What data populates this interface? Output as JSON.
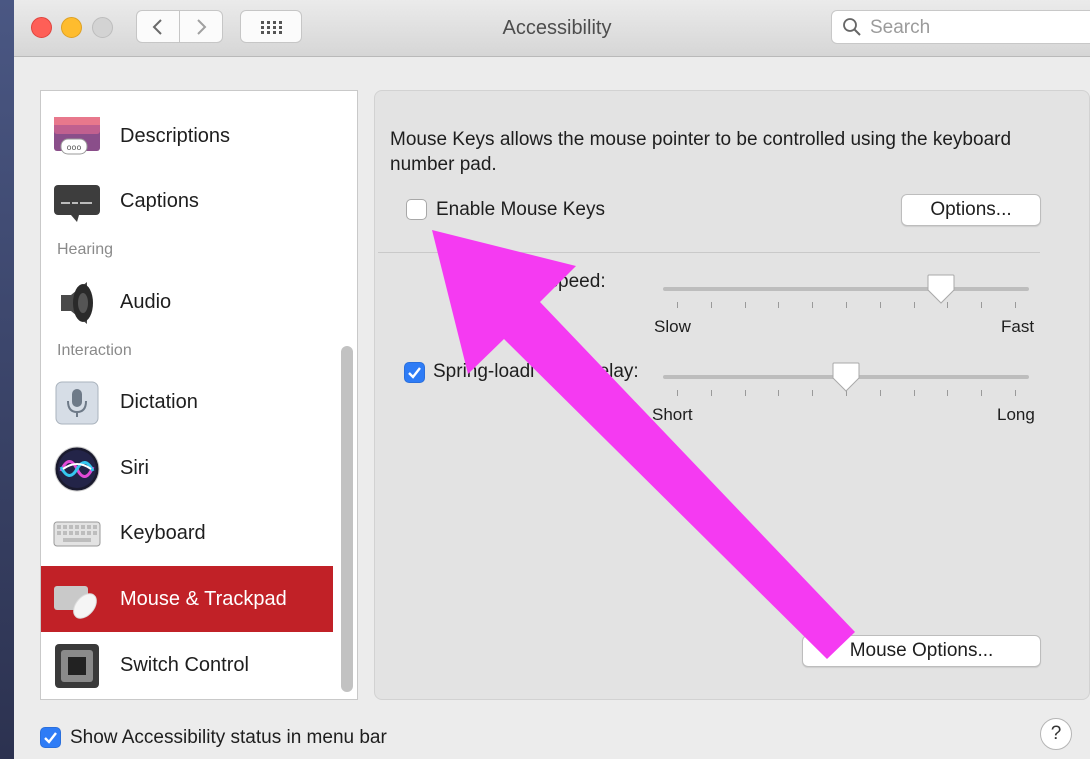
{
  "window": {
    "title": "Accessibility",
    "search_placeholder": "Search"
  },
  "sidebar": {
    "items": [
      {
        "label": "Descriptions",
        "icon": "descriptions-icon"
      },
      {
        "label": "Captions",
        "icon": "captions-icon"
      },
      {
        "label": "Audio",
        "icon": "speaker-icon"
      },
      {
        "label": "Dictation",
        "icon": "microphone-icon"
      },
      {
        "label": "Siri",
        "icon": "siri-icon"
      },
      {
        "label": "Keyboard",
        "icon": "keyboard-icon"
      },
      {
        "label": "Mouse & Trackpad",
        "icon": "mouse-trackpad-icon",
        "selected": true
      },
      {
        "label": "Switch Control",
        "icon": "switch-control-icon"
      }
    ],
    "sections": [
      "Hearing",
      "Interaction"
    ]
  },
  "panel": {
    "description": "Mouse Keys allows the mouse pointer to be controlled using the keyboard number pad.",
    "mouse_keys": {
      "label": "Enable Mouse Keys",
      "checked": false
    },
    "options_button": "Options...",
    "double_click": {
      "label": "-click speed:",
      "min_label": "Slow",
      "max_label": "Fast",
      "value": 0.78
    },
    "spring_loading": {
      "label": "Spring-loadi",
      "label_tail": "delay:",
      "checked": true,
      "min_label": "Short",
      "max_label": "Long",
      "value": 0.5
    },
    "mouse_options_button": "Mouse Options..."
  },
  "footer": {
    "status_checkbox": {
      "label": "Show Accessibility status in menu bar",
      "checked": true
    },
    "help_label": "?"
  },
  "annotation": {
    "arrow_color": "#f53af2"
  }
}
